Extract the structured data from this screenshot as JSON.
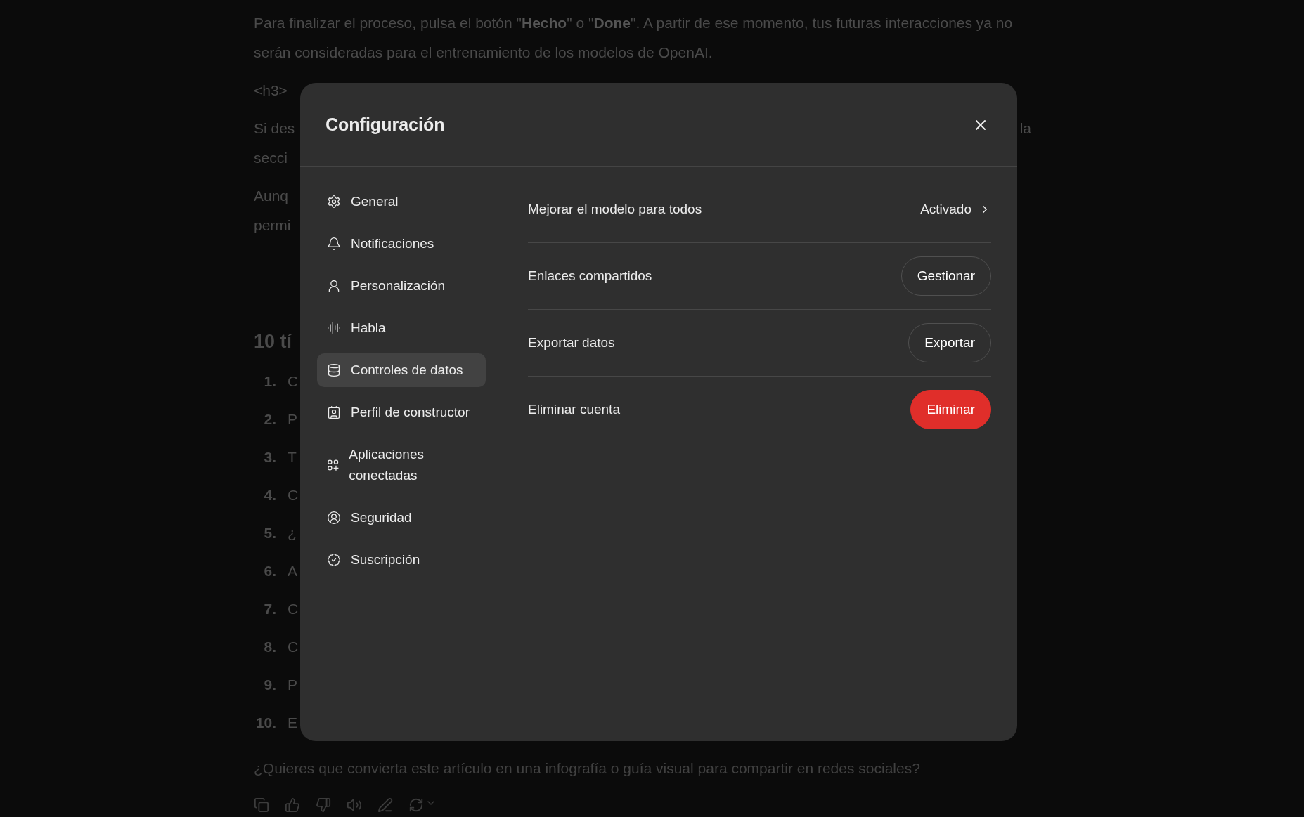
{
  "article": {
    "paragraphs": [
      {
        "lines": [
          {
            "left": "Para finalizar el proceso, pulsa el botón \"**Hecho**\" o \"**Done**\". A partir de ese momento, tus futuras interacciones ya no serán consideradas para el entrenamiento de los modelos de OpenAI."
          }
        ]
      },
      {
        "lines": [
          {
            "left": "<h3>"
          }
        ]
      },
      {
        "lines": [
          {
            "left": "Si des",
            "right": "la"
          },
          {
            "left": "secci"
          }
        ]
      },
      {
        "lines": [
          {
            "left": "Aunq"
          },
          {
            "left": "permi"
          }
        ]
      }
    ],
    "heading": "10 tí",
    "list": [
      {
        "number": "1.",
        "text": "C"
      },
      {
        "number": "2.",
        "text": "P"
      },
      {
        "number": "3.",
        "text": "T"
      },
      {
        "number": "4.",
        "text": "C"
      },
      {
        "number": "5.",
        "text": "¿"
      },
      {
        "number": "6.",
        "text": "A"
      },
      {
        "number": "7.",
        "text": "C"
      },
      {
        "number": "8.",
        "text": "C"
      },
      {
        "number": "9.",
        "text": "P"
      },
      {
        "number": "10.",
        "text": "E"
      }
    ],
    "question": "¿Quieres que convierta este artículo en una infografía o guía visual para compartir en redes sociales?"
  },
  "dialog": {
    "title": "Configuración",
    "sidebar": {
      "items": [
        {
          "label": "General",
          "selected": false
        },
        {
          "label": "Notificaciones",
          "selected": false
        },
        {
          "label": "Personalización",
          "selected": false
        },
        {
          "label": "Habla",
          "selected": false
        },
        {
          "label": "Controles de datos",
          "selected": true
        },
        {
          "label": "Perfil de constructor",
          "selected": false
        },
        {
          "label": "Aplicaciones conectadas",
          "selected": false
        },
        {
          "label": "Seguridad",
          "selected": false
        },
        {
          "label": "Suscripción",
          "selected": false
        }
      ]
    },
    "settings": [
      {
        "label": "Mejorar el modelo para todos",
        "kind": "link",
        "value": "Activado"
      },
      {
        "label": "Enlaces compartidos",
        "kind": "button",
        "value": "Gestionar"
      },
      {
        "label": "Exportar datos",
        "kind": "button",
        "value": "Exportar"
      },
      {
        "label": "Eliminar cuenta",
        "kind": "danger",
        "value": "Eliminar"
      }
    ]
  }
}
